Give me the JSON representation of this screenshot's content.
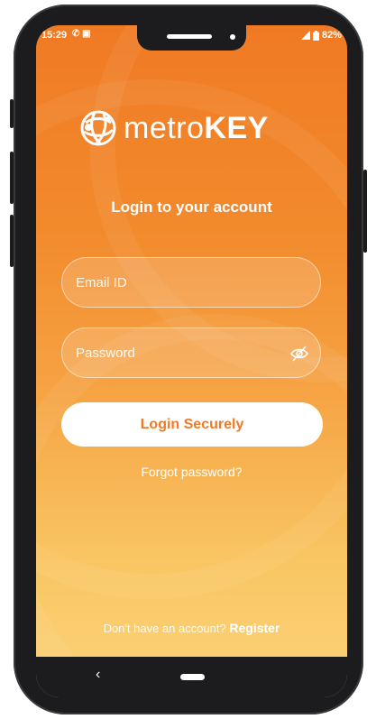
{
  "status_bar": {
    "time": "15:29",
    "left_icons": "✆ ▣",
    "battery": "82%"
  },
  "logo": {
    "prefix": "metro",
    "suffix": "KEY"
  },
  "login": {
    "heading": "Login to your account",
    "email_placeholder": "Email ID",
    "email_value": "",
    "password_placeholder": "Password",
    "password_value": "",
    "submit_label": "Login Securely",
    "forgot_label": "Forgot password?",
    "no_account_text": "Don't have an account?",
    "register_label": "Register"
  },
  "nav": {
    "back_glyph": "‹"
  },
  "colors": {
    "accent": "#f07a24",
    "gradient_bottom": "#fad47a",
    "text": "#ffffff"
  }
}
